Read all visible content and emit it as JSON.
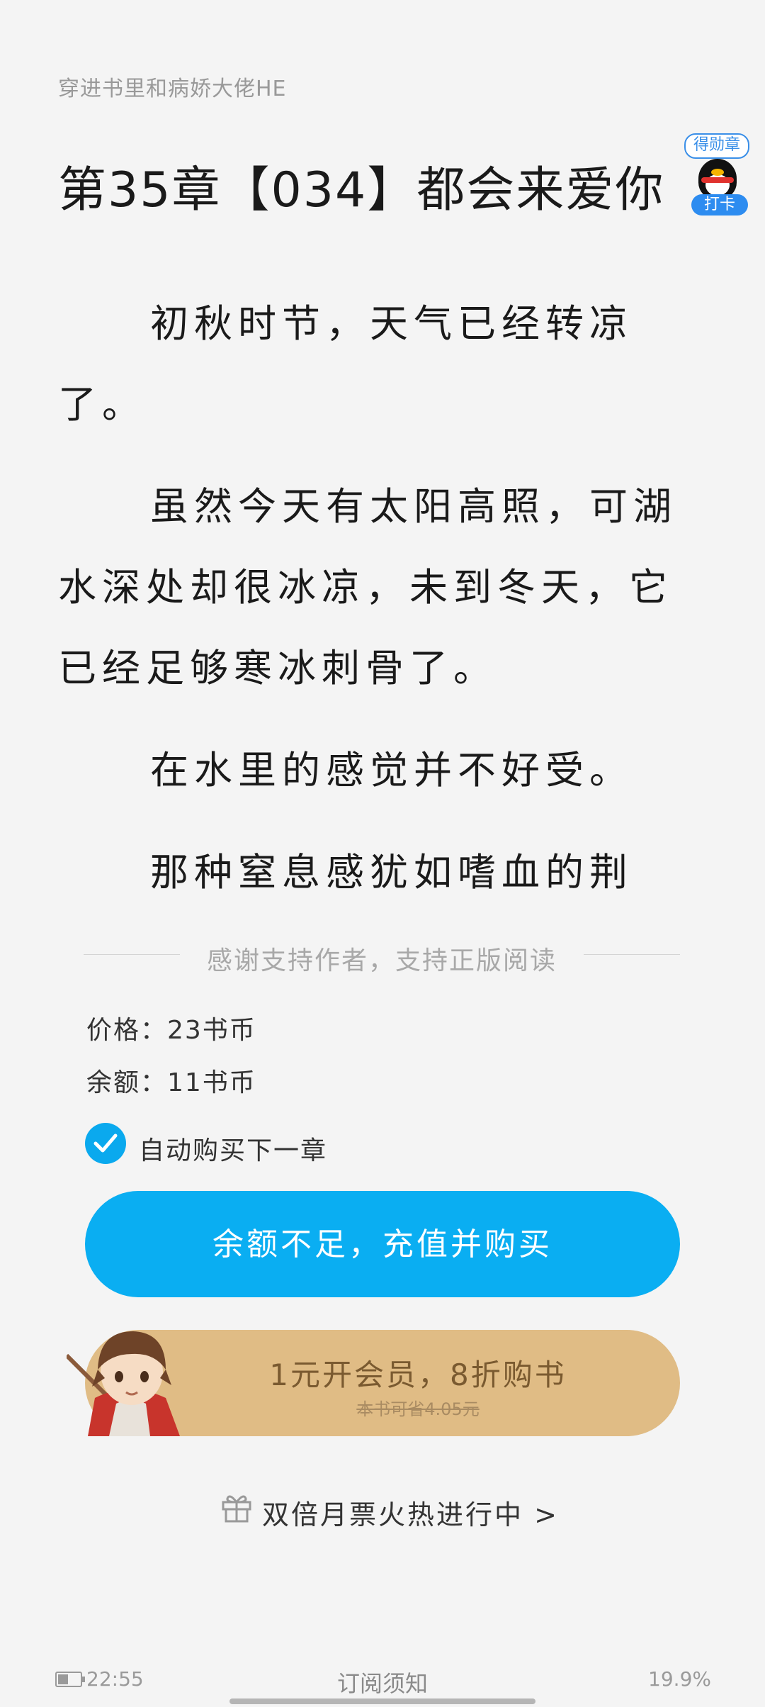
{
  "book_title": "穿进书里和病娇大佬HE",
  "chapter_title": "第35章【034】都会来爱你",
  "badge": {
    "top_label": "得勋章",
    "bottom_label": "打卡"
  },
  "paragraphs": [
    "初秋时节，天气已经转凉了。",
    "虽然今天有太阳高照，可湖水深处却很冰凉，未到冬天，它已经足够寒冰刺骨了。",
    "在水里的感觉并不好受。",
    "那种窒息感犹如嗜血的荆"
  ],
  "purchase": {
    "support_text": "感谢支持作者，支持正版阅读",
    "price_label": "价格：23书币",
    "balance_label": "余额：11书币",
    "auto_buy_label": "自动购买下一章",
    "auto_buy_checked": true,
    "recharge_button": "余额不足，充值并购买",
    "member_main": "1元开会员，8折购书",
    "member_sub": "本书可省4.05元",
    "monthly_ticket": "双倍月票火热进行中 >"
  },
  "status_bar": {
    "battery_level": 0.45,
    "time": "22:55",
    "notice": "订阅须知",
    "progress": "19.9%"
  },
  "colors": {
    "background": "#f4f4f4",
    "accent_blue": "#0aaef2",
    "member_gold": "#e0bc85"
  },
  "icons": {
    "badge": "penguin-medal-icon",
    "check": "check-icon",
    "gift": "gift-icon",
    "battery": "battery-icon"
  }
}
